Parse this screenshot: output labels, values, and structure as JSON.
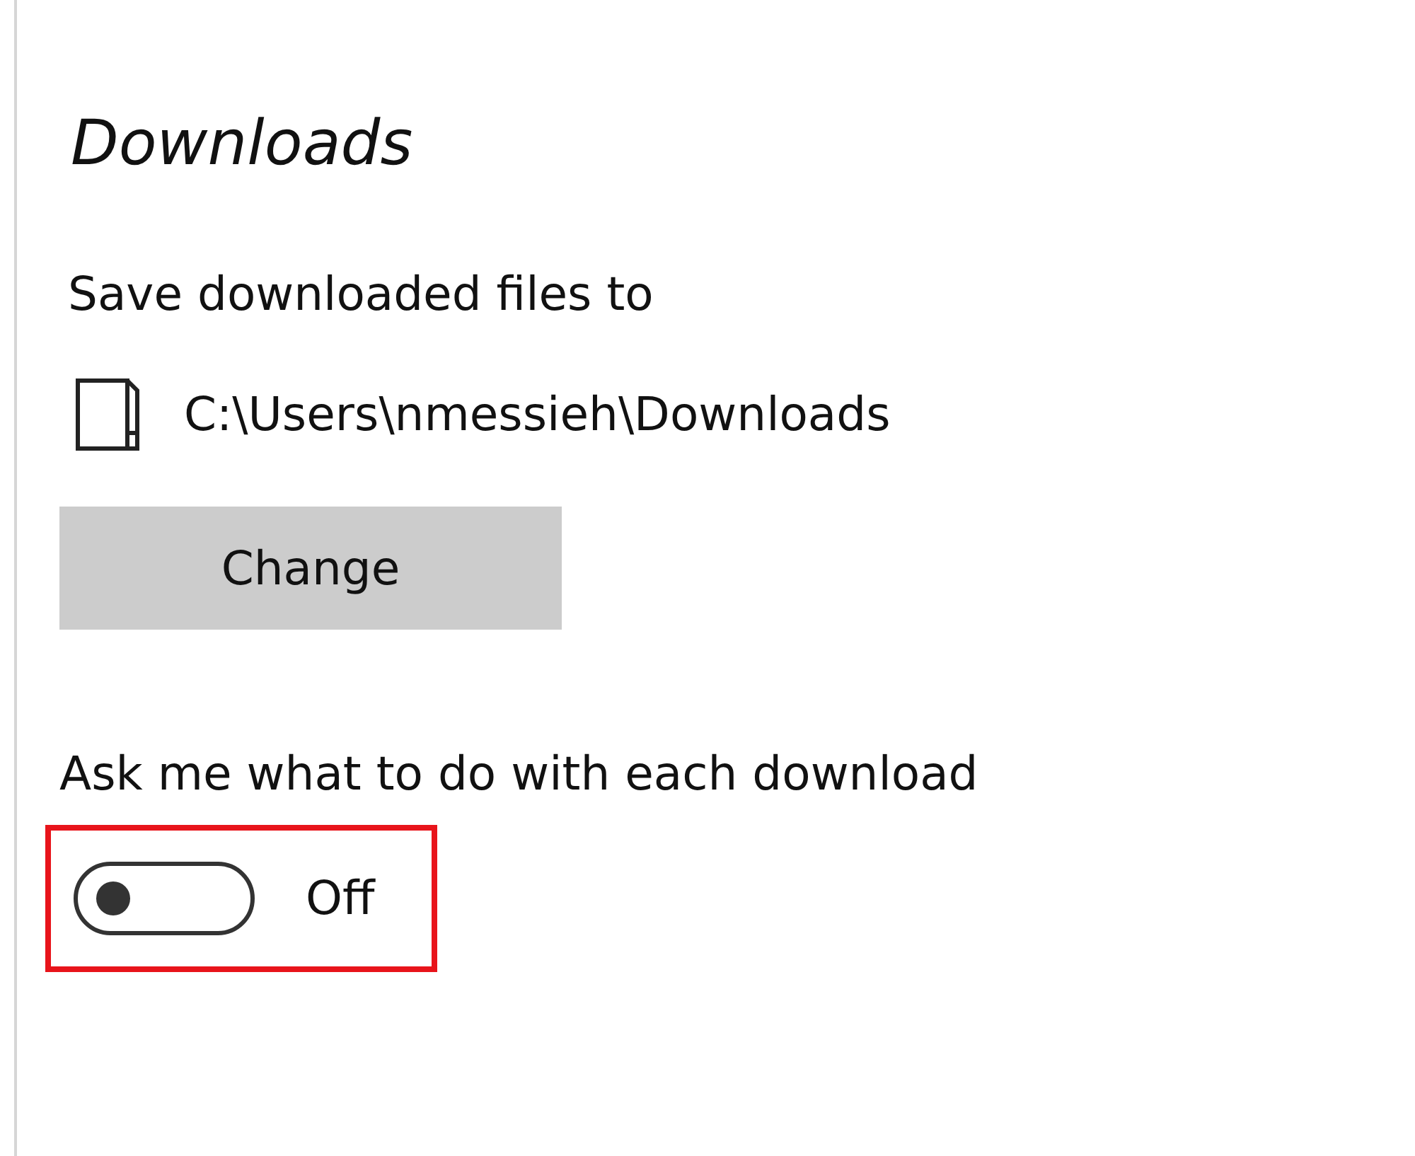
{
  "section": {
    "title": "Downloads"
  },
  "save_location": {
    "label": "Save downloaded files to",
    "path": "C:\\Users\\nmessieh\\Downloads",
    "button": "Change"
  },
  "ask_setting": {
    "label": "Ask me what to do with each download",
    "on": false,
    "state_text": "Off",
    "highlighted": true
  }
}
